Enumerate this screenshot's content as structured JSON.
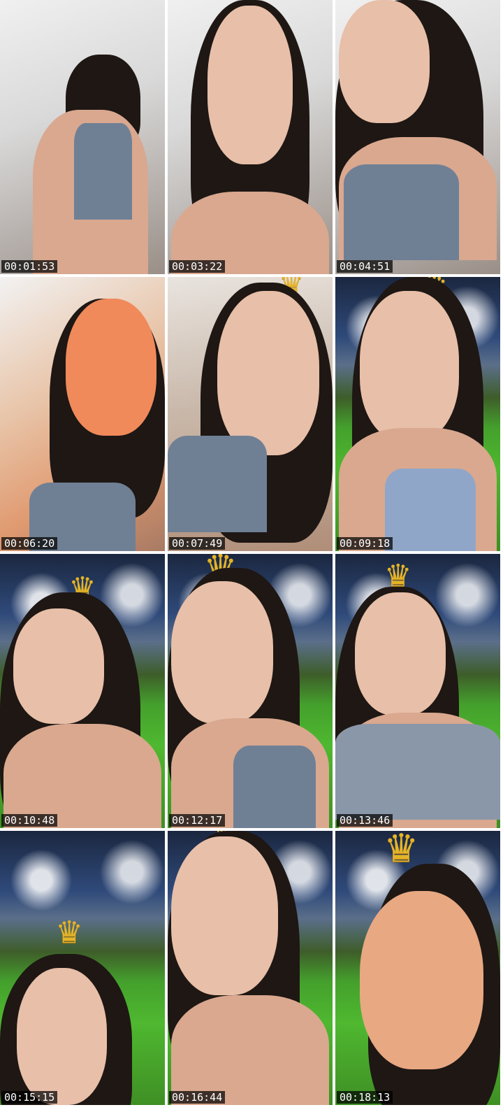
{
  "thumbnails": [
    {
      "timestamp": "00:01:53",
      "scene": "room",
      "crown": false
    },
    {
      "timestamp": "00:03:22",
      "scene": "room",
      "crown": false
    },
    {
      "timestamp": "00:04:51",
      "scene": "room",
      "crown": false
    },
    {
      "timestamp": "00:06:20",
      "scene": "orange",
      "crown": false
    },
    {
      "timestamp": "00:07:49",
      "scene": "warm",
      "crown": true
    },
    {
      "timestamp": "00:09:18",
      "scene": "stadium",
      "crown": true
    },
    {
      "timestamp": "00:10:48",
      "scene": "stadium",
      "crown": true
    },
    {
      "timestamp": "00:12:17",
      "scene": "stadium",
      "crown": true
    },
    {
      "timestamp": "00:13:46",
      "scene": "stadium",
      "crown": true
    },
    {
      "timestamp": "00:15:15",
      "scene": "stadium",
      "crown": true
    },
    {
      "timestamp": "00:16:44",
      "scene": "stadium",
      "crown": true
    },
    {
      "timestamp": "00:18:13",
      "scene": "stadium",
      "crown": true
    }
  ],
  "icons": {
    "crown": "crown-icon"
  },
  "colors": {
    "timestamp_bg": "#000000",
    "timestamp_text": "#ffffff",
    "crown": "#e4b428"
  }
}
